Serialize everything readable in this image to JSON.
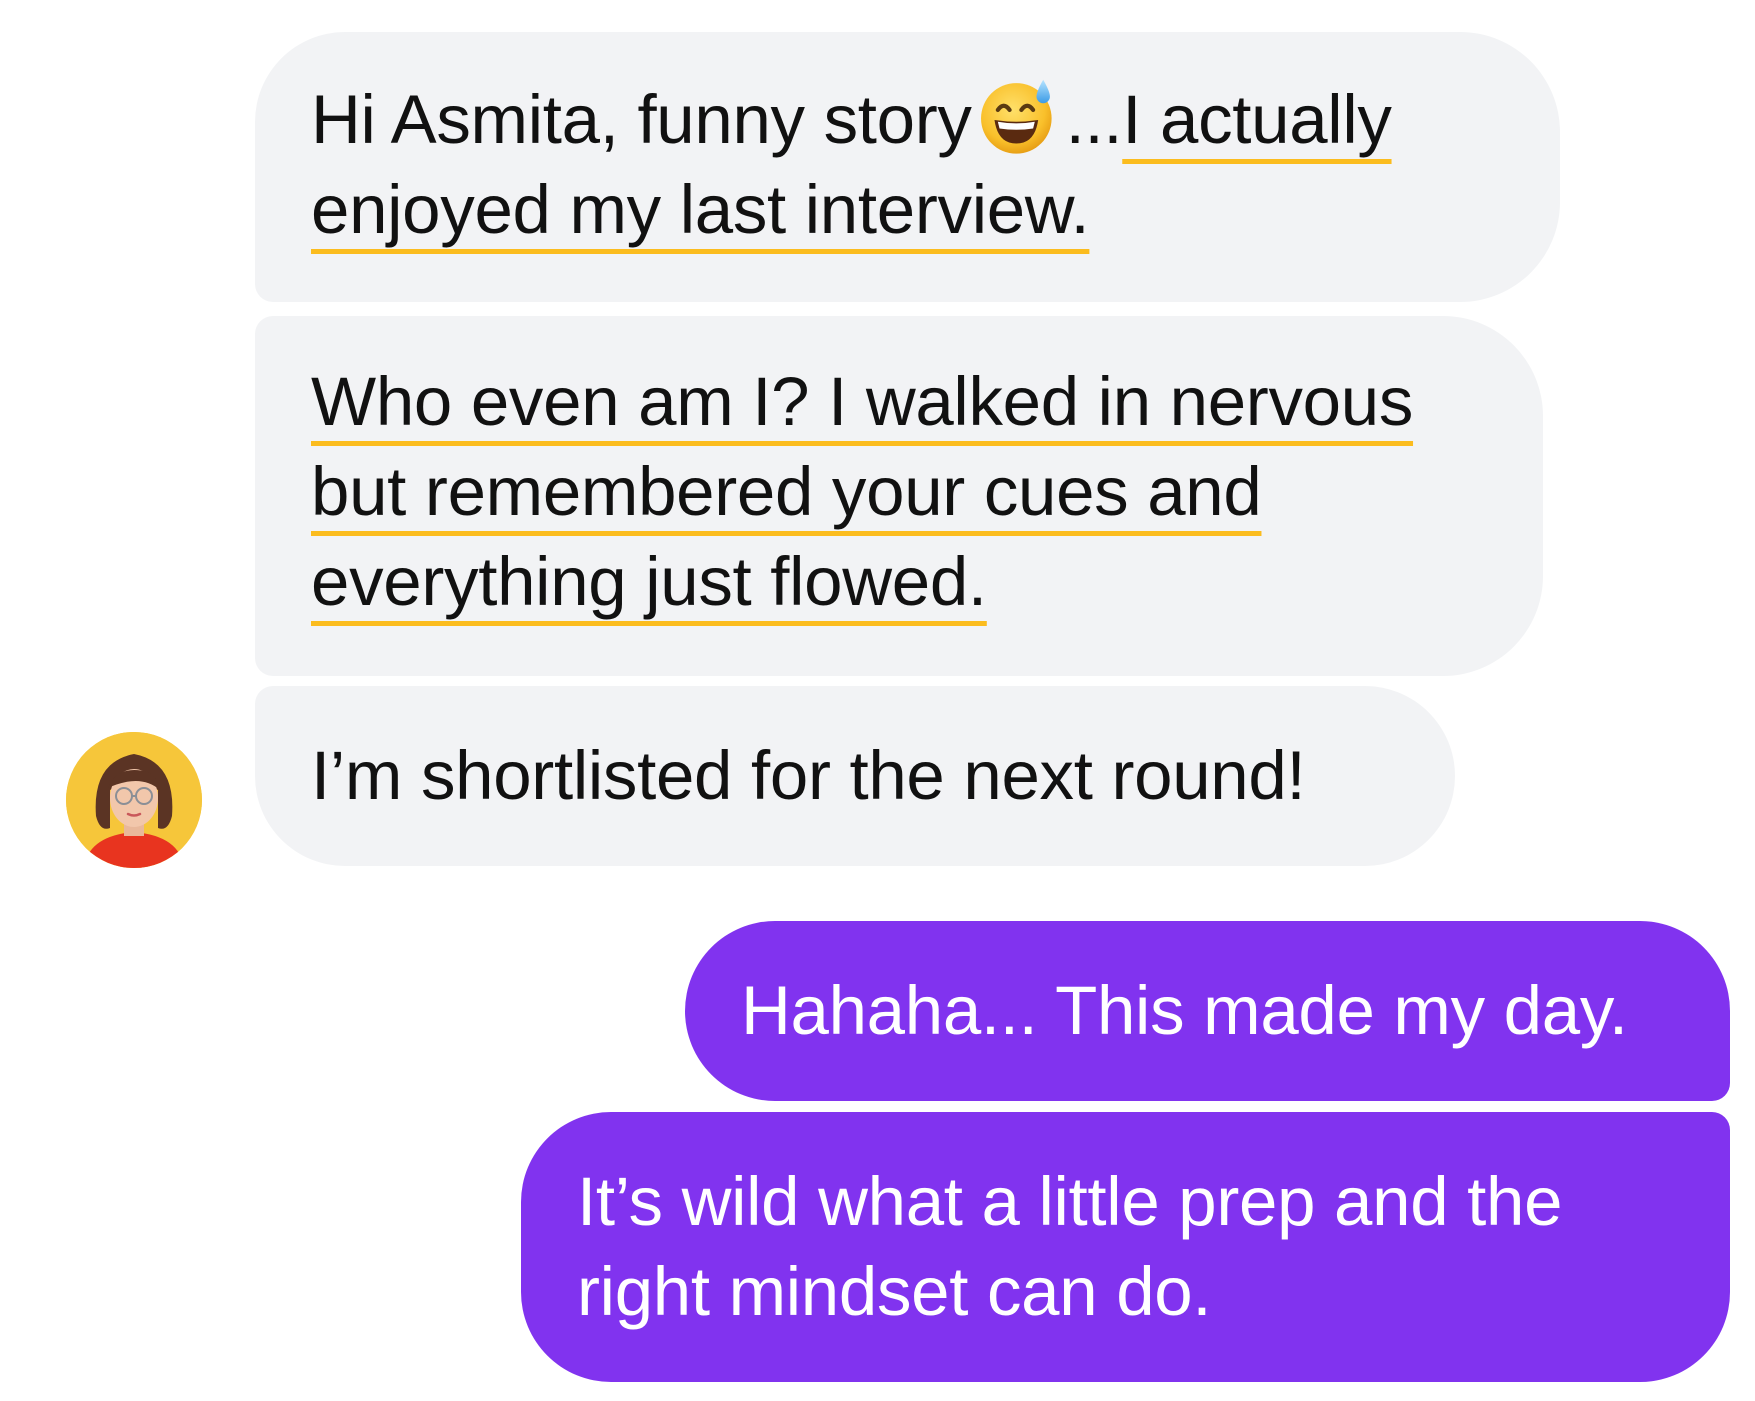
{
  "conversation": {
    "messages": [
      {
        "sender": "contact",
        "parts": [
          {
            "text": "Hi Asmita, funny story"
          },
          {
            "emoji": "grinning-face-with-sweat-emoji"
          },
          {
            "text": "..."
          },
          {
            "text": "I actually enjoyed my last interview.",
            "highlighted": true
          }
        ]
      },
      {
        "sender": "contact",
        "parts": [
          {
            "text": "Who even am I? I walked in nervous but remembered your cues and everything just flowed.",
            "highlighted": true
          }
        ]
      },
      {
        "sender": "contact",
        "parts": [
          {
            "text": "I’m shortlisted for the next round!"
          }
        ]
      },
      {
        "sender": "me",
        "parts": [
          {
            "text": "Hahaha... This made my day."
          }
        ]
      },
      {
        "sender": "me",
        "parts": [
          {
            "text": "It’s wild what a little prep and the right mindset can do."
          }
        ]
      }
    ],
    "contact_avatar": "woman-with-glasses-avatar",
    "highlight_color": "#fbbc1e"
  },
  "colors": {
    "incoming_bubble": "#f2f3f5",
    "outgoing_bubble": "#8133ef",
    "incoming_text": "#111111",
    "outgoing_text": "#ffffff"
  }
}
